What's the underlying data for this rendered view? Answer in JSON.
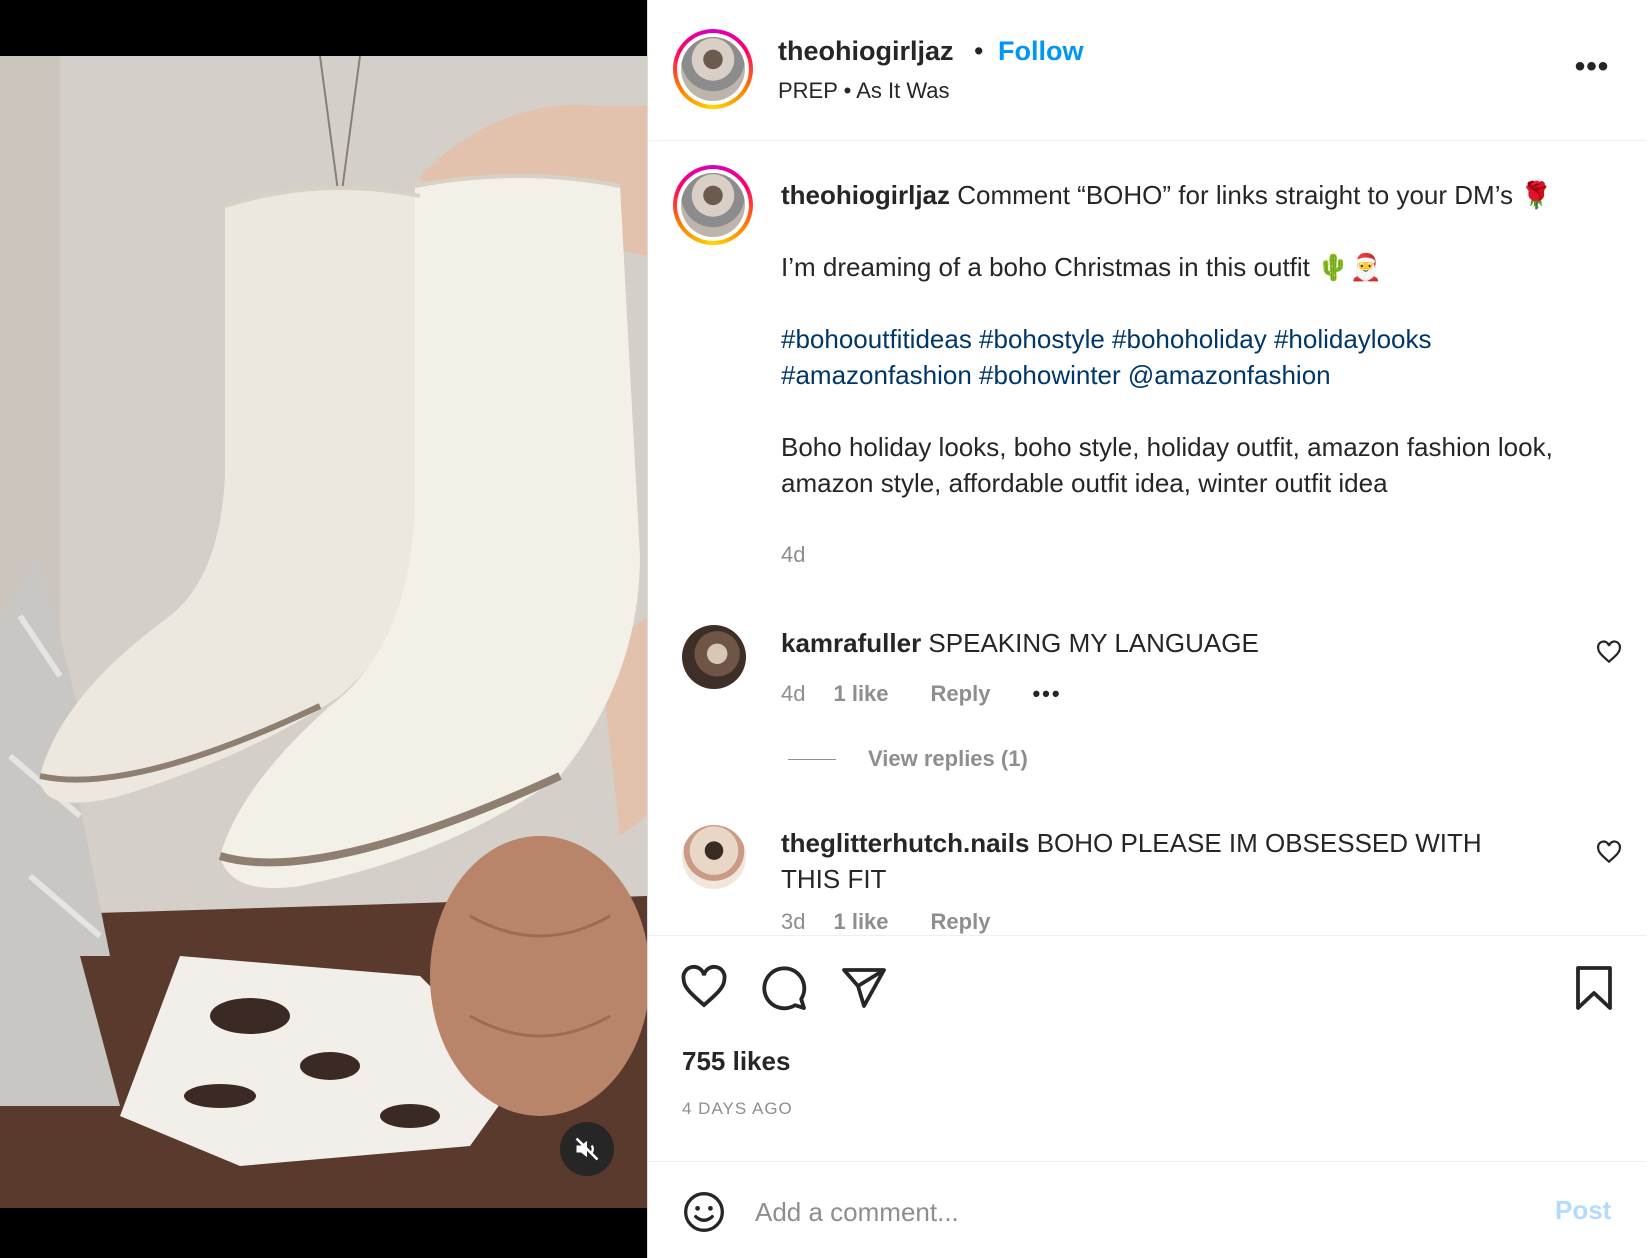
{
  "header": {
    "username": "theohiogirljaz",
    "separator": "•",
    "follow_label": "Follow",
    "audio": "PREP • As It Was",
    "more_label": "•••"
  },
  "caption": {
    "username": "theohiogirljaz",
    "line1": "Comment “BOHO” for links straight to your DM’s 🌹",
    "line2": "I’m dreaming of a boho Christmas in this outfit 🌵🎅",
    "hashtags": "#bohooutfitideas #bohostyle #bohoholiday #holidaylooks #amazonfashion #bohowinter @amazonfashion",
    "line3": "Boho holiday looks, boho style, holiday outfit, amazon fashion look, amazon style, affordable outfit idea, winter outfit idea",
    "time": "4d"
  },
  "comments": [
    {
      "username": "kamrafuller",
      "text": "SPEAKING MY LANGUAGE",
      "time": "4d",
      "likes": "1 like",
      "reply": "Reply",
      "more": "•••",
      "view_replies": "View replies (1)"
    },
    {
      "username": "theglitterhutch.nails",
      "text": "BOHO PLEASE IM OBSESSED WITH THIS FIT",
      "time": "3d",
      "likes": "1 like",
      "reply": "Reply"
    }
  ],
  "actions": {
    "likes": "755 likes",
    "date": "4 DAYS AGO"
  },
  "add_comment": {
    "placeholder": "Add a comment...",
    "post_label": "Post"
  },
  "icons": {
    "mute": "speaker-muted-icon",
    "like": "heart-icon",
    "comment": "comment-bubble-icon",
    "share": "paper-plane-icon",
    "save": "bookmark-icon",
    "emoji": "smiley-icon"
  },
  "colors": {
    "accent": "#0095f6",
    "hashtag": "#00376b",
    "muted": "#8e8e8e",
    "post_disabled": "#b3dbff"
  }
}
